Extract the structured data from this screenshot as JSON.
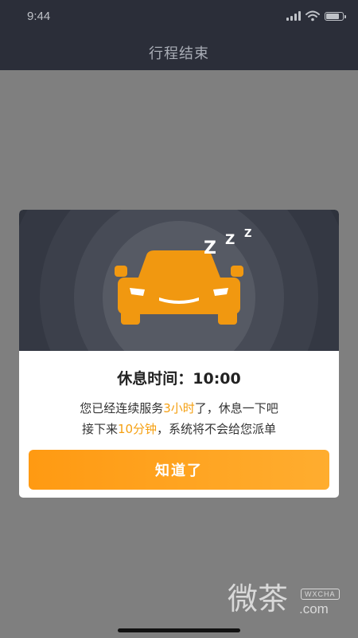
{
  "status_bar": {
    "time": "9:44",
    "signal_icon": "cellular-signal-icon",
    "wifi_icon": "wifi-icon",
    "battery_icon": "battery-icon",
    "battery_level": 0.85
  },
  "nav": {
    "title": "行程结束"
  },
  "dialog": {
    "illustration_icon": "sleeping-car-icon",
    "sleep_letters": [
      "Z",
      "Z",
      "Z"
    ],
    "rest_title": "休息时间：10:00",
    "line1": {
      "before": "您已经连续服务",
      "highlight": "3小时",
      "after": "了，休息一下吧"
    },
    "line2": {
      "before": "接下来",
      "highlight": "10分钟",
      "after": "，系统将不会给您派单"
    },
    "button_label": "知道了"
  },
  "watermark": {
    "cn": "微茶",
    "tag": "WXCHA",
    "domain": ".com"
  },
  "colors": {
    "accent": "#f5a012",
    "button_start": "#ff9a12",
    "button_end": "#ffad2f",
    "overlay": "#7f7f7f",
    "header": "#2b2e39",
    "hero_bg": "#2f333d"
  }
}
